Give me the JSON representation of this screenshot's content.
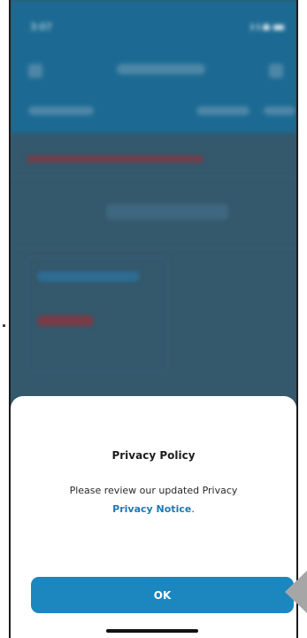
{
  "status_bar": {
    "time": "3:07"
  },
  "dialog": {
    "title": "Privacy Policy",
    "message": "Please review our updated Privacy",
    "link_text": "Privacy Notice",
    "link_suffix": ".",
    "ok_label": "OK"
  },
  "colors": {
    "header": "#1c6a93",
    "overlay": "#34586c",
    "link": "#1f78b4",
    "ok_button": "#1c87bf"
  }
}
